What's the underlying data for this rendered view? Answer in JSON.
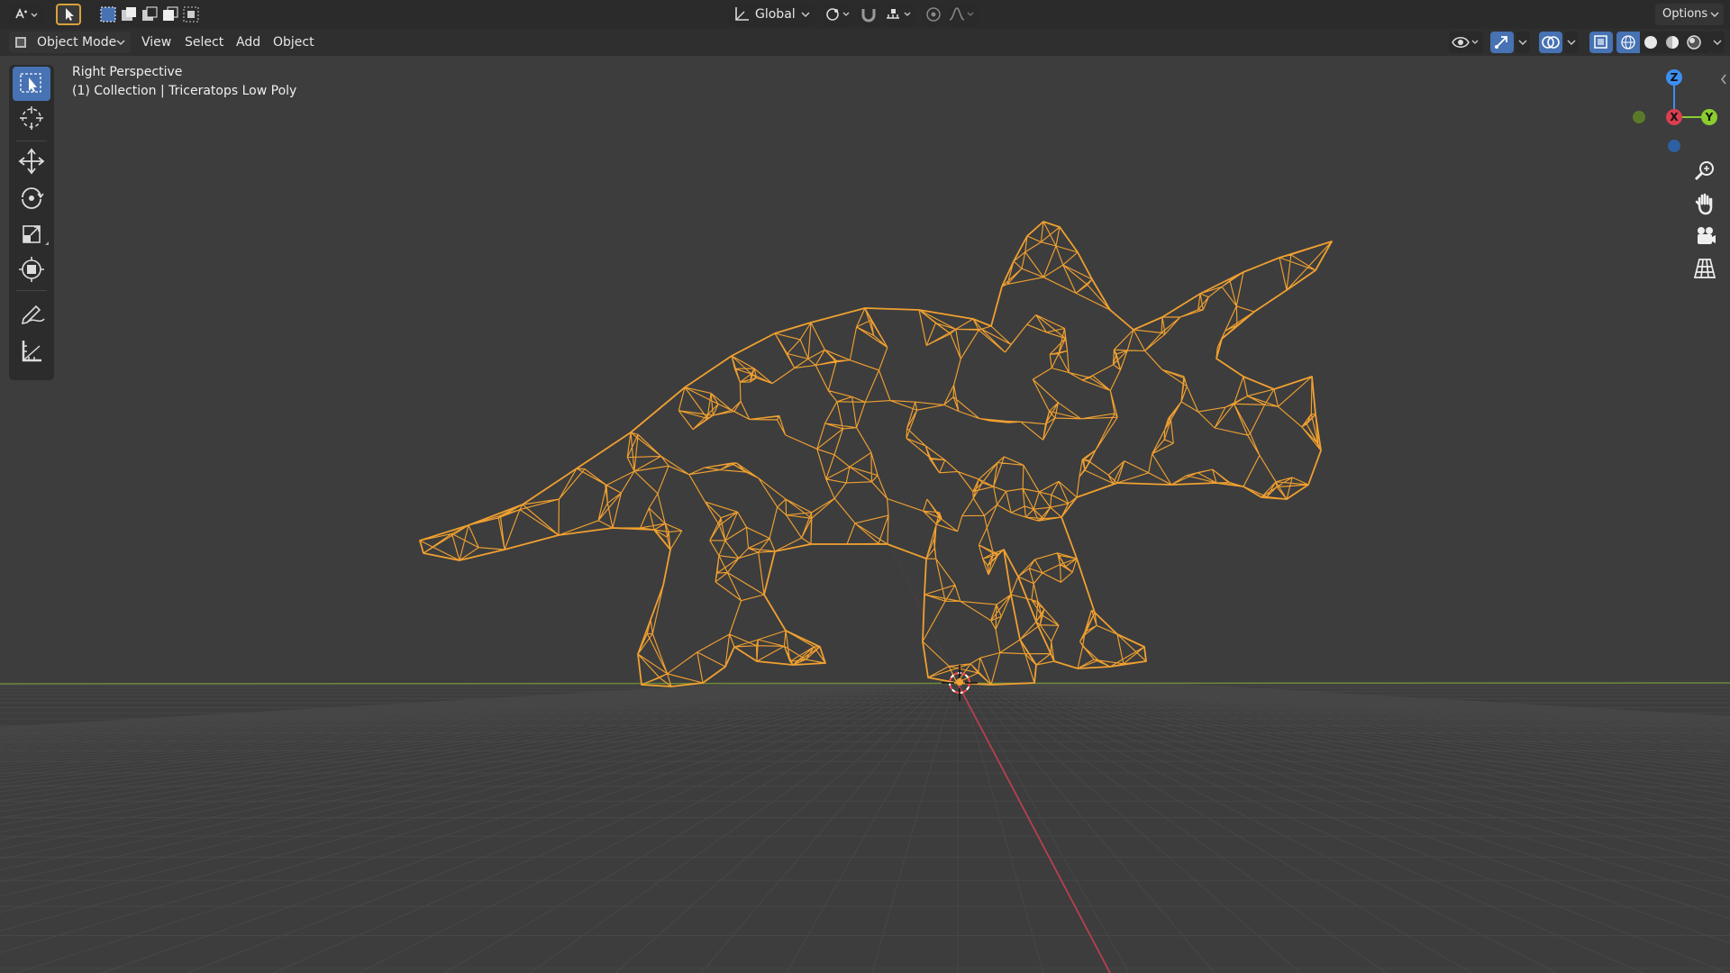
{
  "topbar": {
    "transform_orientation": "Global",
    "options_label": "Options"
  },
  "header": {
    "mode_label": "Object Mode",
    "menus": [
      "View",
      "Select",
      "Add",
      "Object"
    ]
  },
  "viewport": {
    "view_name": "Right Perspective",
    "collection_info": "(1) Collection | Triceratops Low Poly"
  },
  "gizmo": {
    "axis_z": "Z",
    "axis_x": "X",
    "axis_y": "Y"
  },
  "tools": [
    "select-box",
    "cursor",
    "move",
    "rotate",
    "scale",
    "transform",
    "annotate",
    "measure"
  ],
  "colors": {
    "wire": "#f0a030",
    "background": "#3d3d3d",
    "accent": "#4772b3",
    "x_axis": "#d93f4f",
    "y_axis": "#8bcd2f",
    "z_axis": "#3d8ef0"
  }
}
